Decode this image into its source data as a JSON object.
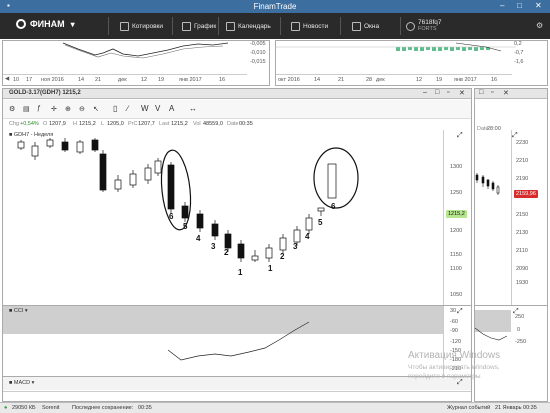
{
  "app": {
    "title": "FinamTrade"
  },
  "toolbar": {
    "brand": "ФИНАМ",
    "items": [
      {
        "label": "Котировки",
        "icon": "quotes-icon"
      },
      {
        "label": "График",
        "icon": "chart-icon"
      },
      {
        "label": "Календарь",
        "icon": "calendar-icon"
      },
      {
        "label": "Новости",
        "icon": "news-icon"
      },
      {
        "label": "Окна",
        "icon": "windows-icon"
      }
    ],
    "account": {
      "id": "7618fq7",
      "market": "FORTS"
    }
  },
  "top_left_chart": {
    "y_ticks": [
      "-0,005",
      "-0,010",
      "-0,015"
    ],
    "x_ticks": [
      "10",
      "17",
      "ноя 2016",
      "14",
      "21",
      "дек",
      "12",
      "19",
      "янв 2017",
      "16"
    ]
  },
  "top_right_chart": {
    "y_ticks": [
      "0,2",
      "-0,7",
      "-1,6"
    ],
    "x_ticks": [
      "окт 2016",
      "14",
      "21",
      "28",
      "дек",
      "12",
      "19",
      "янв 2017",
      "16"
    ]
  },
  "main_chart": {
    "tab_title": "GOLD-3.17(GDH7) 1215,2",
    "ohlc": {
      "change": "+0,54%",
      "open_label": "O",
      "open": "1207,9",
      "high_label": "H",
      "high": "1215,2",
      "low_label": "L",
      "low": "1205,0",
      "prev_close_label": "PrC",
      "prev_close": "1207,7",
      "last_label": "Last",
      "last": "1215,2",
      "vol_label": "Vol",
      "vol": "48559,0",
      "date_label": "Date",
      "date": "00:35"
    },
    "legend": "GDH7 - Неделя",
    "y_ticks": [
      "1300",
      "1250",
      "1200",
      "1150",
      "1100",
      "1050"
    ],
    "last_price": "1215,2",
    "annotations": [
      "6",
      "5",
      "4",
      "3",
      "2",
      "1",
      "1",
      "2",
      "3",
      "4",
      "5",
      "6"
    ]
  },
  "cci_panel": {
    "label": "CCI",
    "y_ticks": [
      "30",
      "-60",
      "-90",
      "-120",
      "-150",
      "-180",
      "-210"
    ]
  },
  "macd_panel": {
    "label": "MACD"
  },
  "right_chart": {
    "date_label": "Date",
    "date": "28:00",
    "y_ticks": [
      "2230",
      "2210",
      "2190",
      "2170",
      "2150",
      "2130",
      "2110",
      "2090",
      "1930"
    ],
    "last_price": "2159,96",
    "cci_ticks": [
      "250",
      "0",
      "-250"
    ]
  },
  "status_bar": {
    "memory": "29050 КБ",
    "mode": "Sorenit",
    "save_label": "Последнее сохранение:",
    "save_time": "00:35",
    "journal": "Журнал событий",
    "datetime": "21 Январь 00:35"
  },
  "watermark": {
    "title": "Активация Windows",
    "line1": "Чтобы активировать Windows,",
    "line2": "перейдите в параметры"
  }
}
